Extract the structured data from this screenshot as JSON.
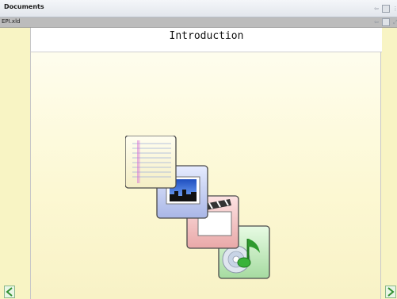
{
  "panel": {
    "title": "Documents"
  },
  "tab": {
    "label": "EPI.xld"
  },
  "slide": {
    "title": "Introduction"
  },
  "icons": {
    "pin": "pin-icon",
    "restore": "restore-icon",
    "expand": "expand-icon",
    "previous": "previous-arrow-icon",
    "next": "next-arrow-icon",
    "art": "media-types-illustration"
  },
  "colors": {
    "slide_bg": "#fcf8d3",
    "side_strip": "#f8f4c4",
    "nav_arrow": "#3a9a3a"
  }
}
